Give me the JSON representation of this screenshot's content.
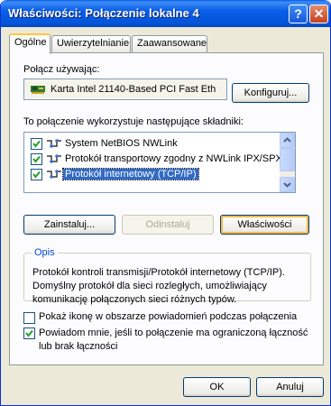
{
  "window": {
    "title": "Właściwości: Połączenie lokalne 4",
    "help_button": "?",
    "close_button": "✕"
  },
  "tabs": [
    {
      "label": "Ogólne",
      "active": true
    },
    {
      "label": "Uwierzytelnianie",
      "active": false
    },
    {
      "label": "Zaawansowane",
      "active": false
    }
  ],
  "connect_using": {
    "label": "Połącz używając:",
    "adapter": "Karta Intel 21140-Based PCI Fast Eth",
    "configure_button": "Konfiguruj..."
  },
  "components": {
    "label": "To połączenie wykorzystuje następujące składniki:",
    "items": [
      {
        "label": "System NetBIOS NWLink",
        "checked": true,
        "selected": false
      },
      {
        "label": "Protokół transportowy zgodny z NWLink IPX/SPX/Net",
        "checked": true,
        "selected": false
      },
      {
        "label": "Protokół internetowy (TCP/IP)",
        "checked": true,
        "selected": true
      }
    ],
    "install_button": "Zainstaluj...",
    "uninstall_button": "Odinstaluj",
    "properties_button": "Właściwości"
  },
  "description": {
    "label": "Opis",
    "text": "Protokół kontroli transmisji/Protokół internetowy (TCP/IP). Domyślny protokół dla sieci rozległych, umożliwiający komunikację połączonych sieci różnych typów."
  },
  "options": {
    "show_icon_label": "Pokaż ikonę w obszarze powiadomień podczas połączenia",
    "show_icon_checked": false,
    "notify_label": "Powiadom mnie, jeśli to połączenie ma ograniczoną łączność lub brak łączności",
    "notify_checked": true
  },
  "footer": {
    "ok_button": "OK",
    "cancel_button": "Anuluj"
  },
  "colors": {
    "titlebar": "#0a5ee8",
    "selection": "#316ac5",
    "group_label": "#0046d5",
    "face": "#ece9d8"
  }
}
